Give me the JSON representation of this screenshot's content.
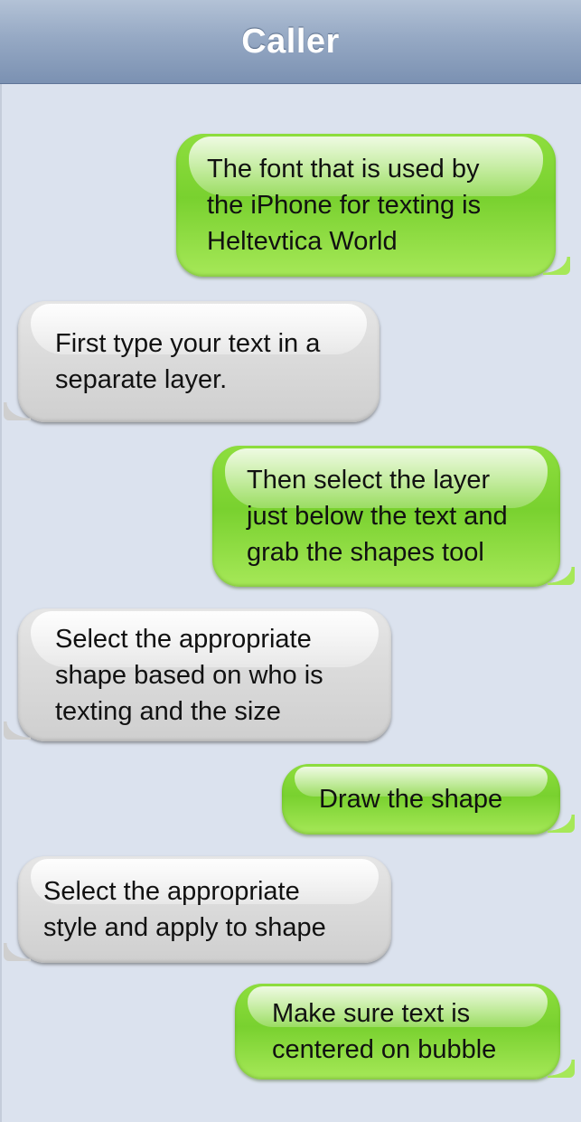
{
  "header": {
    "title": "Caller"
  },
  "messages": [
    {
      "side": "out",
      "text": "The font that is used by\nthe iPhone for texting is\nHeltevtica World"
    },
    {
      "side": "in",
      "text": "First type your text in a\nseparate layer."
    },
    {
      "side": "out",
      "text": "Then select the layer\njust below the text and\ngrab the shapes tool"
    },
    {
      "side": "in",
      "text": "Select the appropriate\nshape based on who is\ntexting and the size"
    },
    {
      "side": "out",
      "text": "Draw the shape"
    },
    {
      "side": "in",
      "text": "Select the appropriate\nstyle and apply to shape"
    },
    {
      "side": "out",
      "text": "Make sure text is\ncentered on bubble"
    }
  ],
  "colors": {
    "outgoing_bubble": "#8ede3e",
    "incoming_bubble": "#dcdcdc",
    "header": "#8fa3c0",
    "background": "#dbe2ee"
  }
}
